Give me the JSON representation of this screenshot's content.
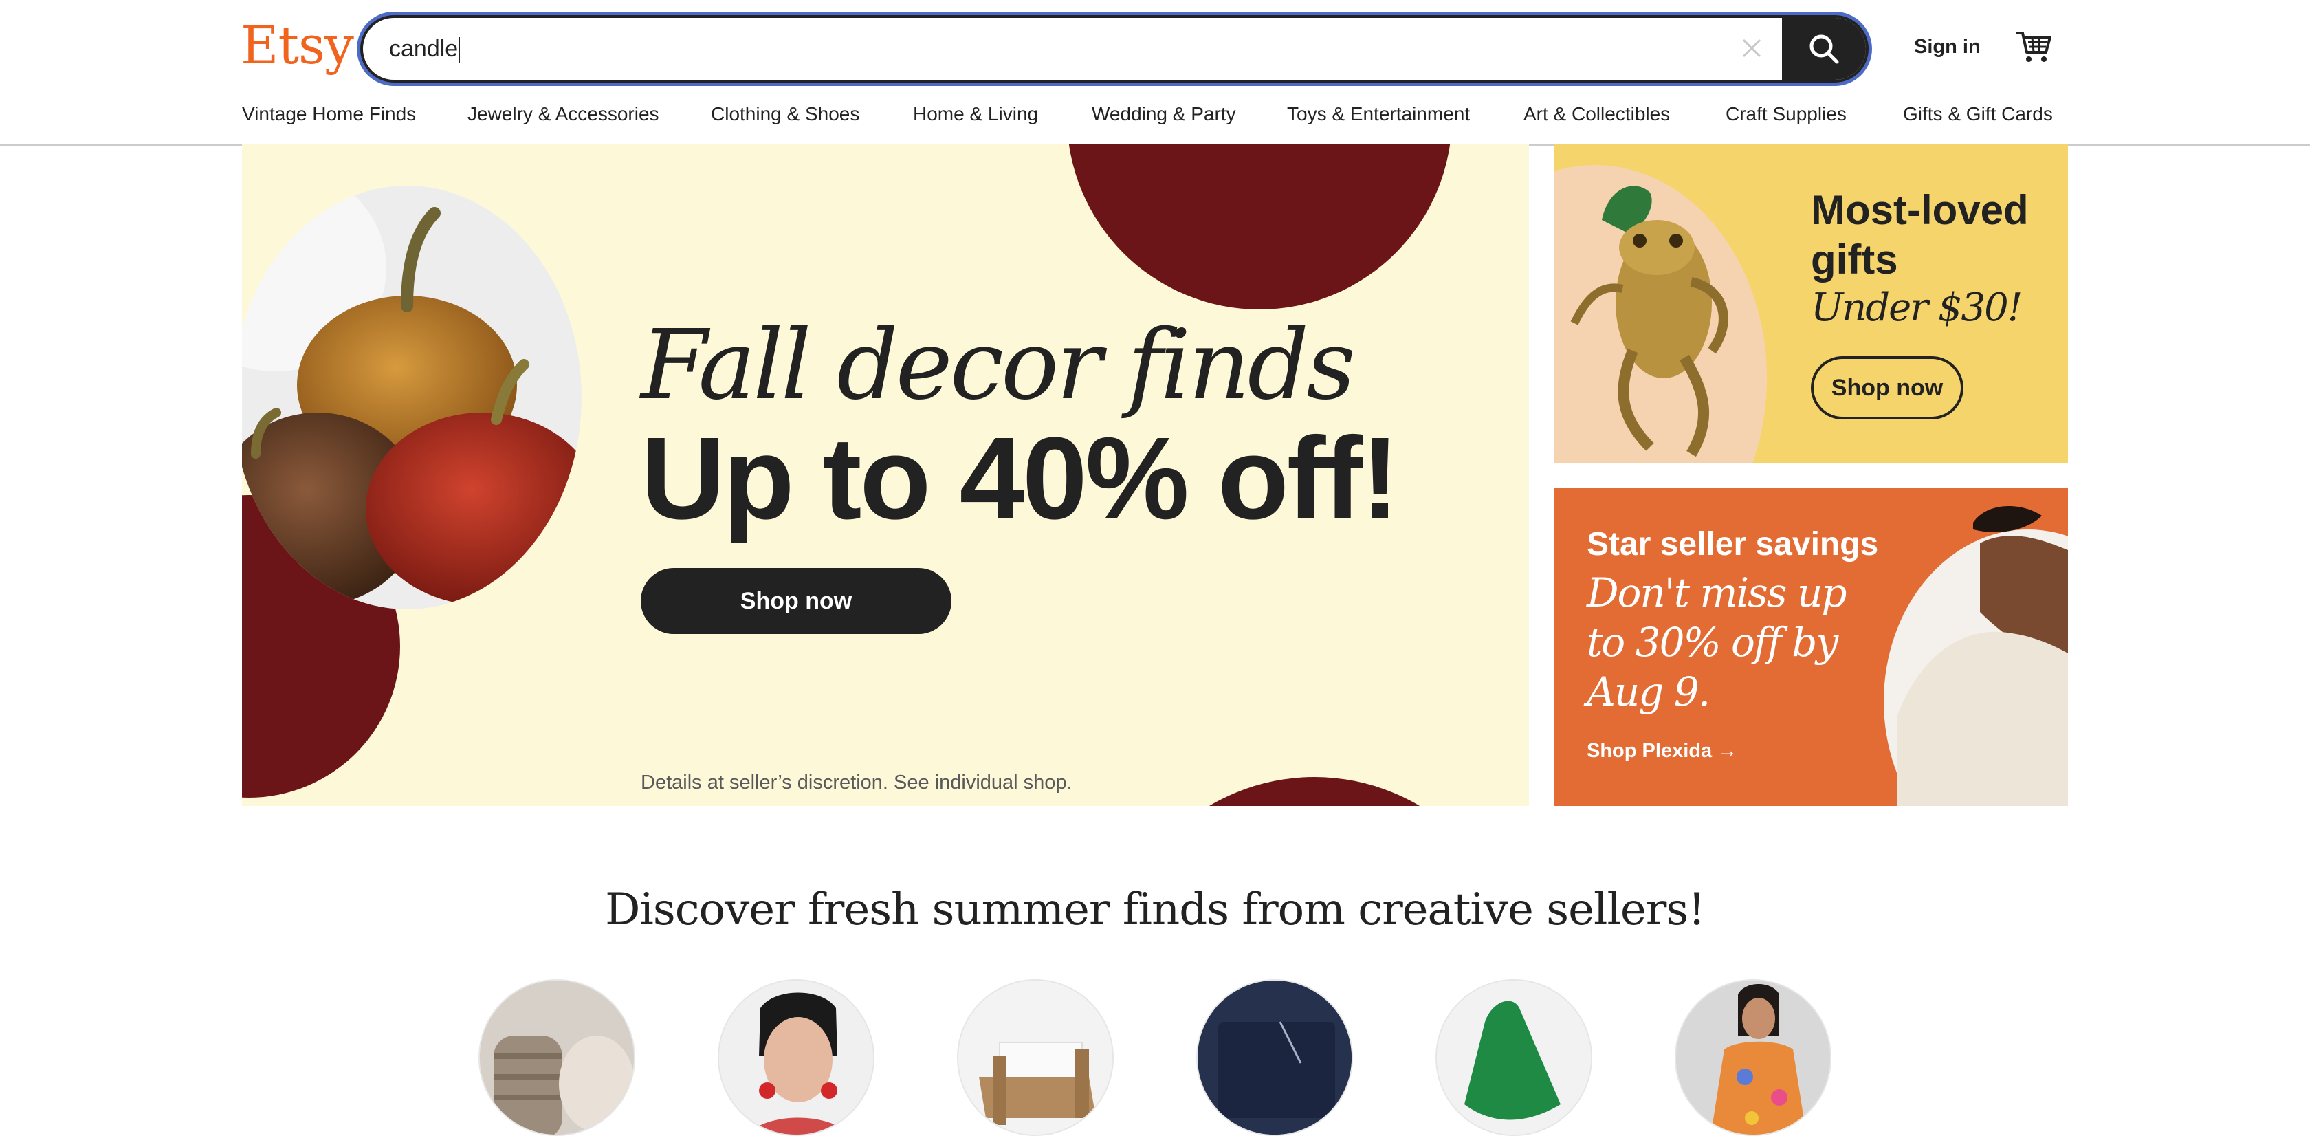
{
  "header": {
    "logo": "Etsy",
    "search_value": "candle",
    "sign_in": "Sign in"
  },
  "nav": [
    "Vintage Home Finds",
    "Jewelry & Accessories",
    "Clothing & Shoes",
    "Home & Living",
    "Wedding & Party",
    "Toys & Entertainment",
    "Art & Collectibles",
    "Craft Supplies",
    "Gifts & Gift Cards"
  ],
  "hero": {
    "title_italic": "Fall decor finds",
    "title_bold": "Up to 40% off!",
    "button": "Shop now",
    "note": "Details at seller’s discretion. See individual shop."
  },
  "card_gifts": {
    "title_line1": "Most-loved",
    "title_line2": "gifts",
    "subtitle": "Under $30!",
    "button": "Shop now"
  },
  "card_star": {
    "title": "Star seller savings",
    "line1": "Don't miss up",
    "line2": "to 30% off by",
    "line3": "Aug 9.",
    "link": "Shop Plexida",
    "link_arrow": "→"
  },
  "discover": {
    "heading": "Discover fresh summer finds from creative sellers!"
  },
  "colors": {
    "brand": "#F1641E",
    "hero_bg": "#FDF9D8",
    "maroon": "#6B1518",
    "yellow_card": "#F5D46C",
    "orange_card": "#E36C34",
    "focus_ring": "#4D6BC6"
  }
}
